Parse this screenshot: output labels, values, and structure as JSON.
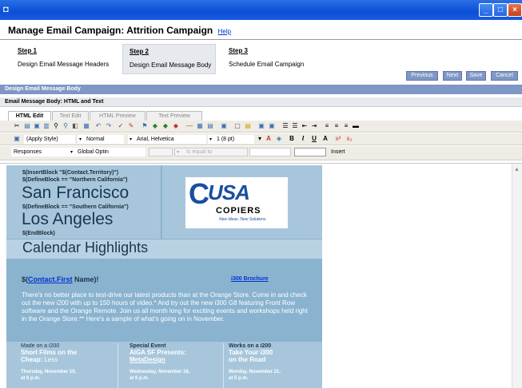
{
  "window": {
    "minimize": "_",
    "maximize": "□",
    "close": "×"
  },
  "header": {
    "title": "Manage Email Campaign: Attrition Campaign",
    "help": "Help"
  },
  "steps": [
    {
      "number": "Step 1",
      "label": "Design Email Message Headers"
    },
    {
      "number": "Step 2",
      "label": "Design Email Message Body"
    },
    {
      "number": "Step 3",
      "label": "Schedule Email Campaign"
    }
  ],
  "actions": {
    "previous": "Previous",
    "next": "Next",
    "save": "Save",
    "cancel": "Cancel"
  },
  "section_title": "Design Email Message Body",
  "subsection_title": "Email Message Body: HTML and Text",
  "tabs": [
    "HTML Edit",
    "Text Edit",
    "HTML Preview",
    "Text Preview"
  ],
  "format_bar": {
    "style": "(Apply Style)",
    "paragraph": "Normal",
    "font": "Arial, Helvetica",
    "size": "1 (8 pt)"
  },
  "token_bar": {
    "category": "Responses",
    "field": "Global Optin",
    "operator": "Is equal to",
    "insert": "Insert"
  },
  "email": {
    "code_insert": "$(InsertBlock \"$(Contact.Territory)\")",
    "code_define1": "$(DefineBlock == \"Northern California\")",
    "city1": "San Francisco",
    "code_define2": "$(DefineBlock == \"Southern California\")",
    "city2": "Los Angeles",
    "code_end": "$(EndBlock)",
    "logo_usa": "USA",
    "logo_copiers": "COPIERS",
    "logo_tag": "New Ideas. New Solutions.",
    "calendar_title": "Calendar Highlights",
    "greeting_pre": "$(",
    "greeting_link": "Contact.First",
    "greeting_post": " Name)!",
    "brochure_link": "i300 Brochure",
    "body": "There's no better place to test-drive our latest products than at the Orange Store. Come in and check out the new i200 with up to 150 hours of video.* And try out the new i300 G8 featuring Front Row software and the Orange Remote. Join us all month long for exciting events and workshops held right in the Orange Store.** Here's a sample of what's going on in November.",
    "events": [
      {
        "small": "Made on a i200",
        "title1": "Short Films on the",
        "title2_plain": "Cheap: ",
        "title2_em": "Less",
        "date1": "Thursday, November 10,",
        "date2": "at 6 p.m."
      },
      {
        "small": "Special Event",
        "title1": "AIGA SF Presents:",
        "title2_plain": "MetaDesign",
        "title2_em": "",
        "date1": "Wednesday, November 16,",
        "date2": "at 6 p.m."
      },
      {
        "small": "Works on a i200",
        "title1": "Take Your i300",
        "title2_plain": "on the Road",
        "title2_em": "",
        "date1": "Monday, November 21,",
        "date2": "at 5 p.m."
      }
    ]
  },
  "colors": {
    "title_bar": "#0b4fd6",
    "section_bar": "#7f97c4",
    "email_bg": "#8ab3cf",
    "email_header": "#a7c6db",
    "link": "#0033cc"
  }
}
